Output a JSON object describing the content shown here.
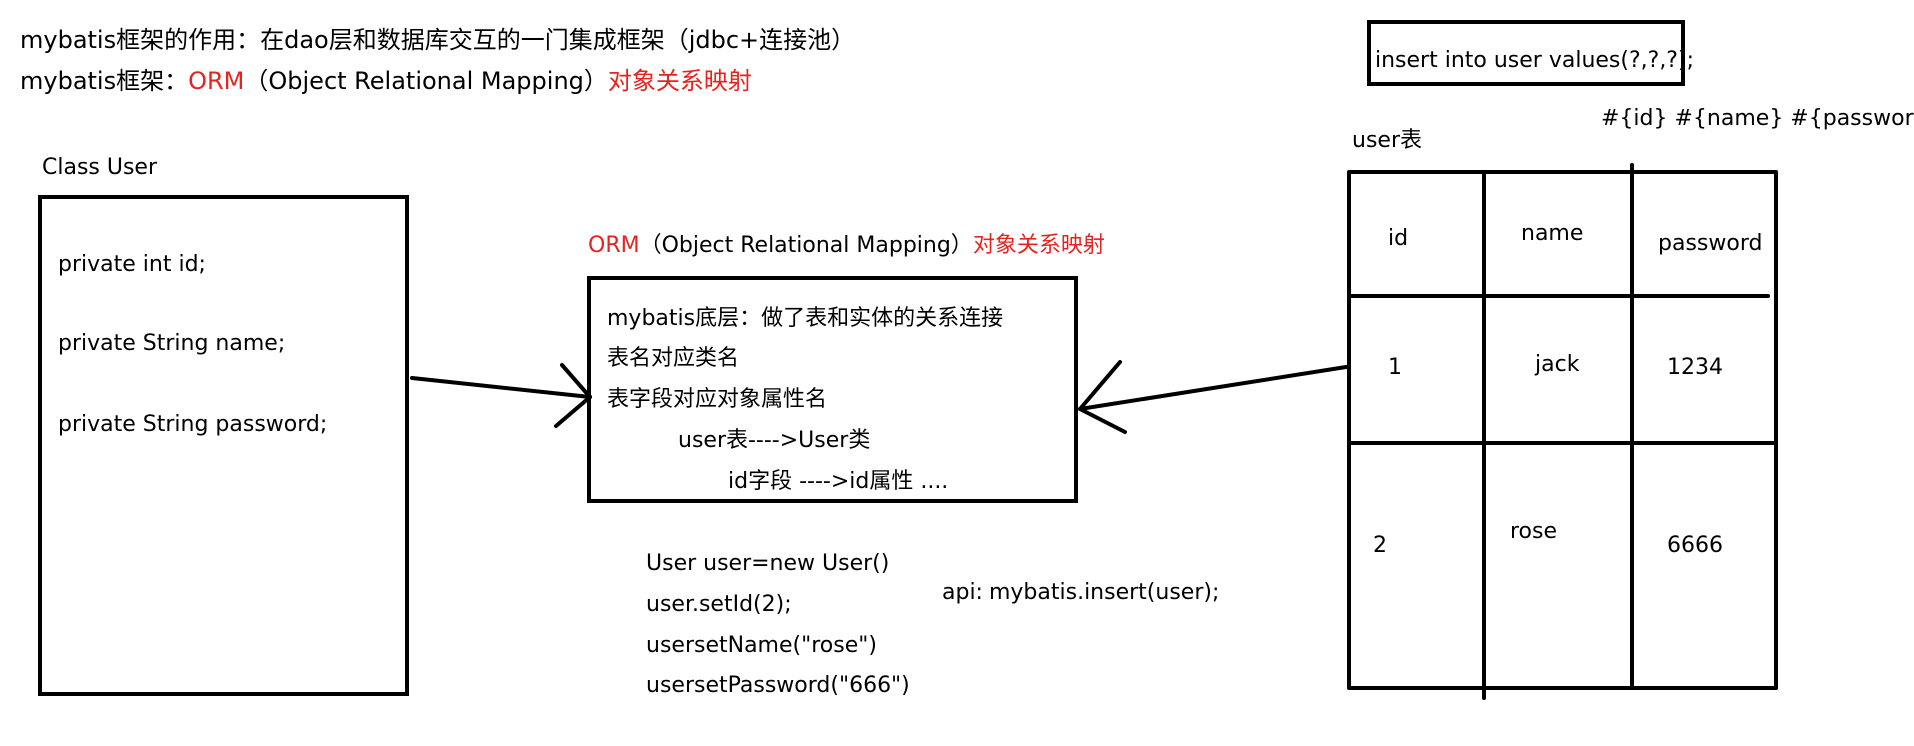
{
  "intro": {
    "line1": "mybatis框架的作用：在dao层和数据库交互的一门集成框架（jdbc+连接池）",
    "line2_prefix": "mybatis框架：",
    "line2_orm": "ORM",
    "line2_full": "（Object Relational Mapping）",
    "line2_cn": "对象关系映射"
  },
  "class_box": {
    "title": "Class User",
    "fields": [
      "private  int id;",
      "private String name;",
      "private String password;"
    ]
  },
  "orm_box": {
    "header_orm": "ORM",
    "header_full": "（Object Relational Mapping）",
    "header_cn": "对象关系映射",
    "lines": [
      "mybatis底层：做了表和实体的关系连接",
      "表名对应类名",
      "表字段对应对象属性名",
      "user表---->User类",
      "id字段 ---->id属性  ...."
    ]
  },
  "code": {
    "lines": [
      "User user=new User()",
      "user.setId(2);",
      "usersetName(\"rose\")",
      "usersetPassword(\"666\")"
    ],
    "api_label": "api:",
    "api_call": "mybatis.insert(user);"
  },
  "sql": {
    "statement": "insert into user values(?,?,?);",
    "params": "#{id} #{name} #{password}"
  },
  "table": {
    "caption": "user表",
    "headers": [
      "id",
      "name",
      "password"
    ],
    "rows": [
      [
        "1",
        "jack",
        "1234"
      ],
      [
        "2",
        "rose",
        "6666"
      ]
    ]
  },
  "colors": {
    "accent_red": "#e8231f",
    "ink": "#000000"
  }
}
